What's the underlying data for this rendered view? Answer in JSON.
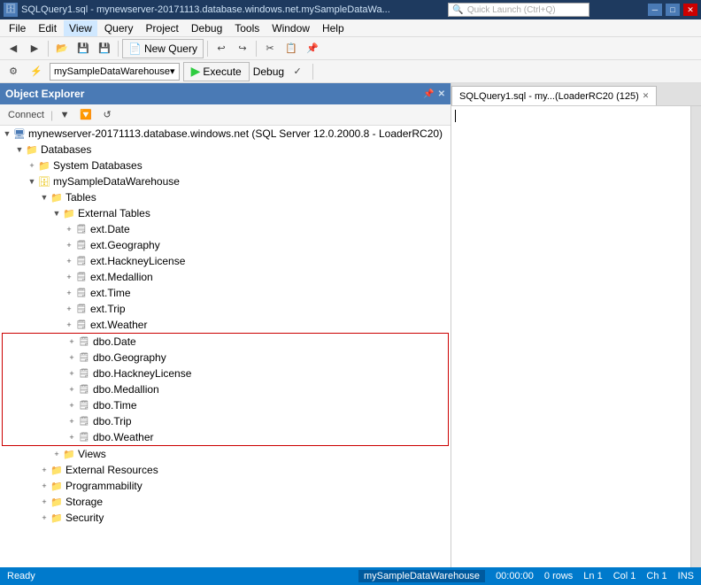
{
  "titlebar": {
    "title": "SQLQuery1.sql - mynewserver-20171113.database.windows.net.mySampleDataWa...",
    "search_placeholder": "Quick Launch (Ctrl+Q)"
  },
  "menubar": {
    "items": [
      "File",
      "Edit",
      "View",
      "Query",
      "Project",
      "Debug",
      "Tools",
      "Window",
      "Help"
    ]
  },
  "toolbar": {
    "new_query_label": "New Query",
    "execute_label": "Execute",
    "debug_label": "Debug",
    "database": "mySampleDataWarehouse"
  },
  "object_explorer": {
    "title": "Object Explorer",
    "connect_label": "Connect",
    "tree": {
      "server": "mynewserver-20171113.database.windows.net (SQL Server 12.0.2000.8 - LoaderRC20)",
      "databases_label": "Databases",
      "system_db_label": "System Databases",
      "warehouse_label": "mySampleDataWarehouse",
      "tables_label": "Tables",
      "external_tables_label": "External Tables",
      "ext_items": [
        "ext.Date",
        "ext.Geography",
        "ext.HackneyLicense",
        "ext.Medallion",
        "ext.Time",
        "ext.Trip",
        "ext.Weather"
      ],
      "dbo_items": [
        "dbo.Date",
        "dbo.Geography",
        "dbo.HackneyLicense",
        "dbo.Medallion",
        "dbo.Time",
        "dbo.Trip",
        "dbo.Weather"
      ],
      "views_label": "Views",
      "external_resources_label": "External Resources",
      "programmability_label": "Programmability",
      "storage_label": "Storage",
      "security_label": "Security"
    }
  },
  "query_panel": {
    "tab_label": "SQLQuery1.sql - my...(LoaderRC20 (125)",
    "tab_close": "✕"
  },
  "statusbar": {
    "ready_label": "Ready",
    "ln_label": "Ln 1",
    "col_label": "Col 1",
    "ch_label": "Ch 1",
    "ins_label": "INS",
    "database": "mySampleDataWarehouse",
    "time": "00:00:00",
    "rows": "0 rows"
  }
}
